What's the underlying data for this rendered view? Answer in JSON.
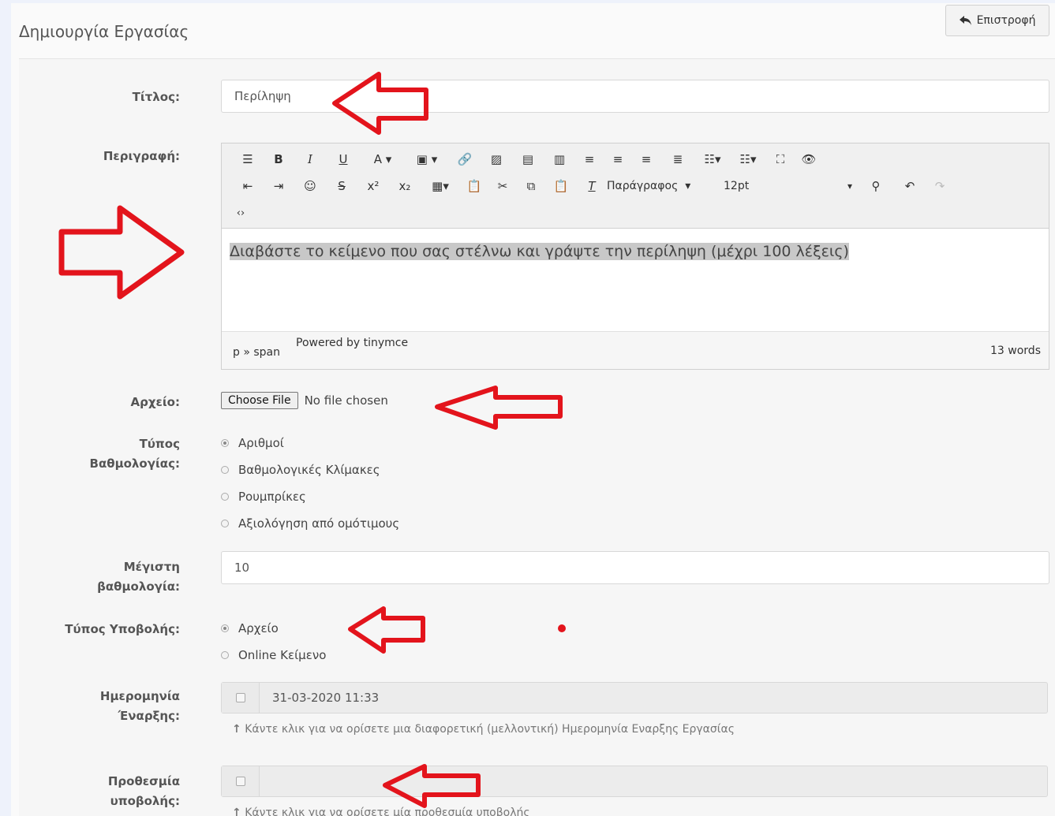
{
  "page": {
    "title": "Δημιουργία Εργασίας",
    "back_label": "Επιστροφή"
  },
  "fields": {
    "title_label": "Τίτλος:",
    "title_value": "Περίληψη",
    "description_label": "Περιγραφή:",
    "file_label": "Αρχείο:",
    "file_button": "Choose File",
    "file_status": "No file chosen",
    "grading_label_1": "Τύπος",
    "grading_label_2": "Βαθμολογίας:",
    "grading_options": [
      "Αριθμοί",
      "Βαθμολογικές Κλίμακες",
      "Ρουμπρίκες",
      "Αξιολόγηση από ομότιμους"
    ],
    "max_grade_label_1": "Μέγιστη",
    "max_grade_label_2": "βαθμολογία:",
    "max_grade_value": "10",
    "submission_label": "Τύπος Υποβολής:",
    "submission_options": [
      "Αρχείο",
      "Online Κείμενο"
    ],
    "start_label_1": "Ημερομηνία",
    "start_label_2": "Έναρξης:",
    "start_value": "31-03-2020 11:33",
    "start_help": "Κάντε κλικ για να ορίσετε μια διαφορετική (μελλοντική) Ημερομηνία Εναρξης Εργασίας",
    "deadline_label_1": "Προθεσμία",
    "deadline_label_2": "υποβολής:",
    "deadline_value": "",
    "deadline_help": "Κάντε κλικ για να ορίσετε μία προθεσμία υποβολής"
  },
  "editor": {
    "format_select": "Παράγραφος",
    "size_select": "12pt",
    "content": "Διαβάστε το κείμενο που σας στέλνω και γράψτε την περίληψη (μέχρι 100 λέξεις)",
    "path": "p » span",
    "powered": "Powered by tinymce",
    "word_count": "13 words"
  },
  "icons": {
    "back": "reply-icon",
    "annotation_color": "#e3141c"
  }
}
